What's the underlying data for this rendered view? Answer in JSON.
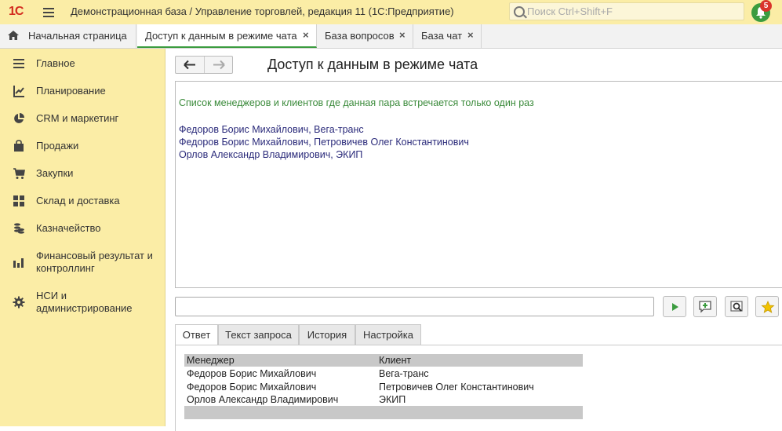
{
  "topbar": {
    "logo": "1С",
    "title": "Демонстрационная база / Управление торговлей, редакция 11  (1С:Предприятие)",
    "search_placeholder": "Поиск Ctrl+Shift+F",
    "notifications_count": "5"
  },
  "tabs": [
    {
      "label": "Начальная страница"
    },
    {
      "label": "Доступ к данным в режиме чата",
      "close": "×"
    },
    {
      "label": "База вопросов",
      "close": "×"
    },
    {
      "label": "База чат",
      "close": "×"
    }
  ],
  "sidebar": {
    "items": [
      {
        "label": "Главное",
        "icon": "menu-lines-icon"
      },
      {
        "label": "Планирование",
        "icon": "planning-icon"
      },
      {
        "label": "CRM и маркетинг",
        "icon": "pie-chart-icon"
      },
      {
        "label": "Продажи",
        "icon": "bag-icon"
      },
      {
        "label": "Закупки",
        "icon": "cart-icon"
      },
      {
        "label": "Склад и доставка",
        "icon": "warehouse-icon"
      },
      {
        "label": "Казначейство",
        "icon": "coins-icon"
      },
      {
        "label": "Финансовый результат и контроллинг",
        "icon": "bar-chart-icon"
      },
      {
        "label": "НСИ и администрирование",
        "icon": "gear-icon"
      }
    ]
  },
  "page": {
    "title": "Доступ к данным в режиме чата"
  },
  "chat": {
    "heading": "Список менеджеров и клиентов где данная пара встречается только один раз",
    "lines": [
      "Федоров Борис Михайлович, Вега-транс",
      "Федоров Борис Михайлович, Петровичев Олег Константинович",
      "Орлов Александр Владимирович, ЭКИП"
    ]
  },
  "input": {
    "value": ""
  },
  "subtabs": [
    {
      "label": "Ответ"
    },
    {
      "label": "Текст запроса"
    },
    {
      "label": "История"
    },
    {
      "label": "Настройка"
    }
  ],
  "result": {
    "columns": [
      "Менеджер",
      "Клиент"
    ],
    "rows": [
      [
        "Федоров Борис Михайлович",
        "Вега-транс"
      ],
      [
        "Федоров Борис Михайлович",
        "Петровичев Олег Константинович"
      ],
      [
        "Орлов Александр Владимирович",
        "ЭКИП"
      ]
    ]
  },
  "colors": {
    "sidebar_bg": "#fbeda6",
    "accent_green": "#3b9c3f",
    "chat_heading": "#3a8a3a",
    "chat_text": "#2a2a7a"
  }
}
